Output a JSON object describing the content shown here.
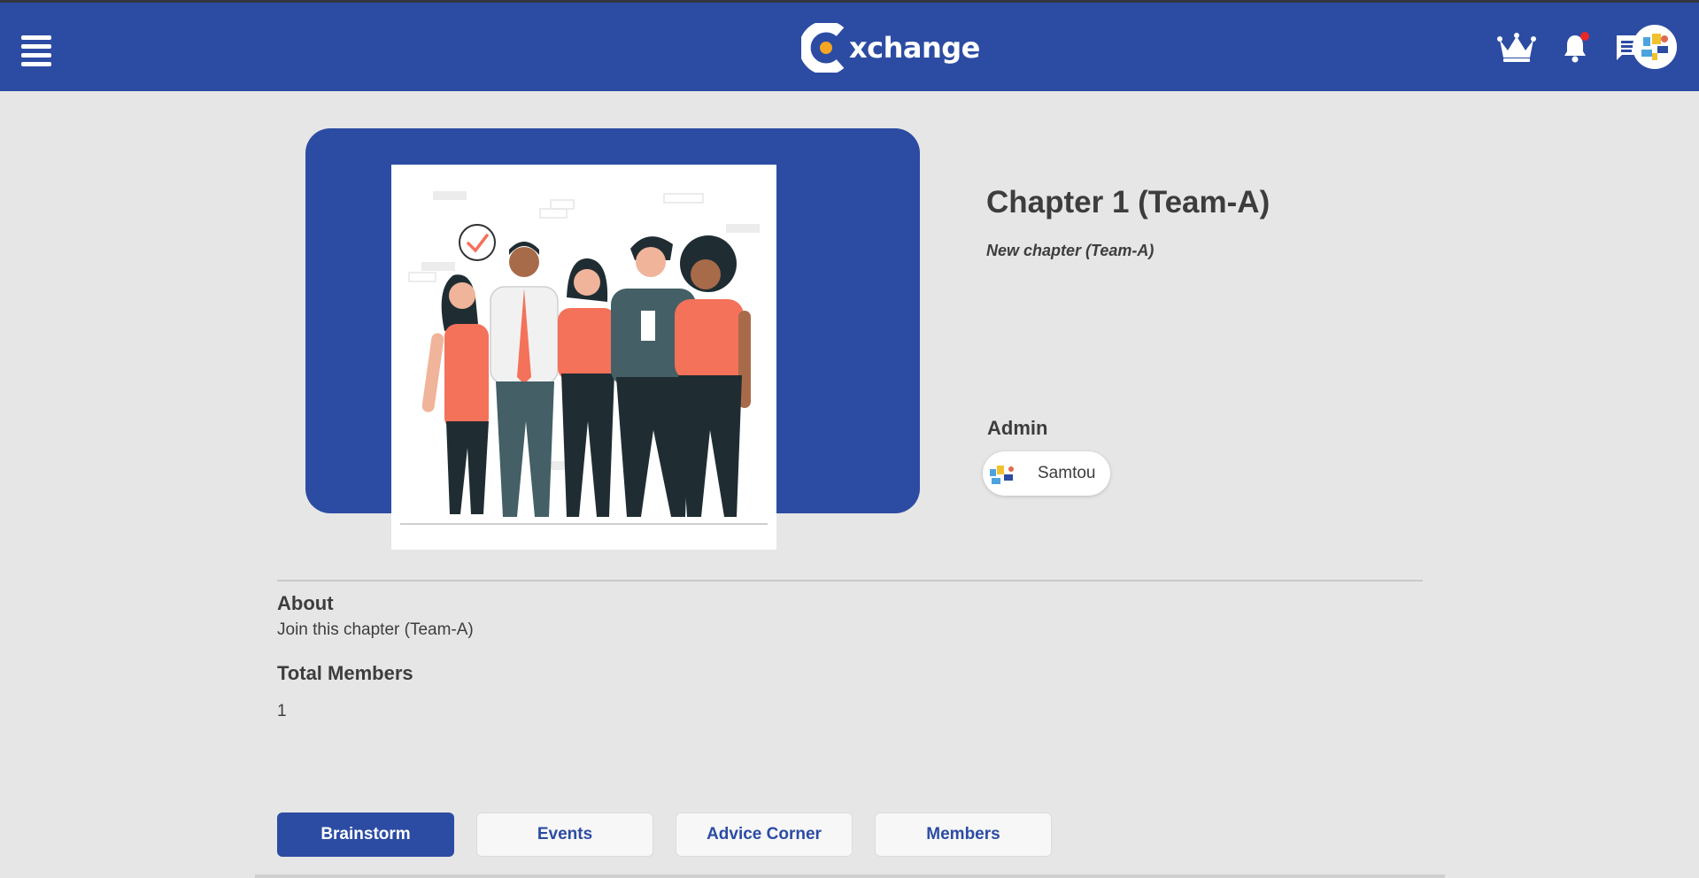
{
  "header": {
    "brand": "xchange",
    "icons": [
      "menu-icon",
      "crown-icon",
      "bell-icon",
      "chat-icon",
      "avatar"
    ],
    "has_unread_notification": true
  },
  "chapter": {
    "title": "Chapter 1 (Team-A)",
    "subtitle": "New chapter (Team-A)",
    "admin_label": "Admin",
    "admin_name": "Samtou",
    "about_heading": "About",
    "about_text": "Join this chapter (Team-A)",
    "members_heading": "Total Members",
    "members_count": "1"
  },
  "tabs": [
    {
      "label": "Brainstorm",
      "active": true
    },
    {
      "label": "Events",
      "active": false
    },
    {
      "label": "Advice Corner",
      "active": false
    },
    {
      "label": "Members",
      "active": false
    }
  ],
  "colors": {
    "primary": "#2c4ca3",
    "page_background": "#e6e6e6",
    "logo_accent": "#f5a623",
    "notification_dot": "#e82828",
    "illustration_accent": "#f4715a"
  }
}
